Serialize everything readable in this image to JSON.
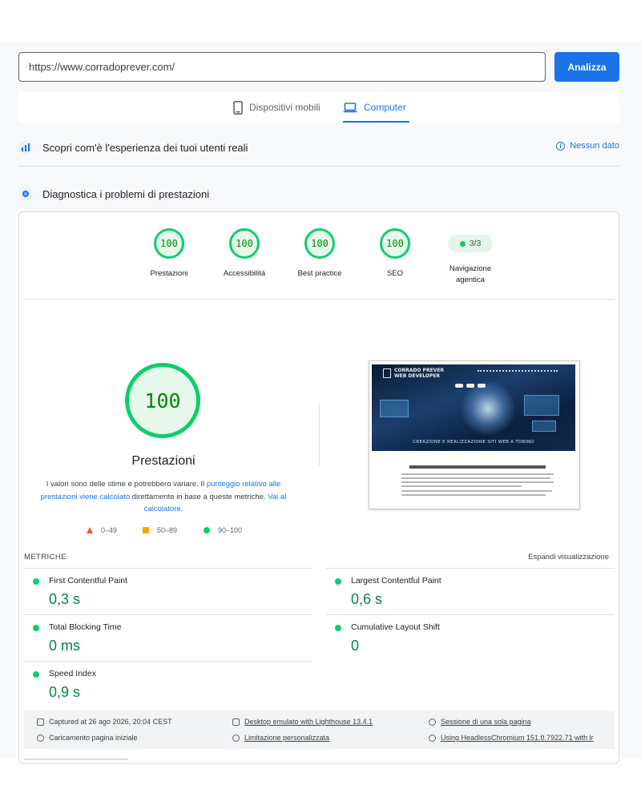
{
  "url_bar": {
    "value": "https://www.corradoprever.com/",
    "analyze_label": "Analizza"
  },
  "device_tabs": {
    "mobile": "Dispositivi mobili",
    "desktop": "Computer",
    "active": "desktop"
  },
  "field_data": {
    "title": "Scopri com'è l'esperienza dei tuoi utenti reali",
    "status": "Nessun dato"
  },
  "lab_data": {
    "title": "Diagnostica i problemi di prestazioni"
  },
  "scores": [
    {
      "value": "100",
      "label": "Prestazioni"
    },
    {
      "value": "100",
      "label": "Accessibilità"
    },
    {
      "value": "100",
      "label": "Best practice"
    },
    {
      "value": "100",
      "label": "SEO"
    }
  ],
  "agentic": {
    "value": "3/3",
    "label": "Navigazione agentica"
  },
  "performance": {
    "score": "100",
    "title": "Prestazioni",
    "desc_1": "I valori sono delle stime e potrebbero variare. Il ",
    "desc_link_1": "punteggio relativo alle prestazioni viene calcolato",
    "desc_2": " direttamente in base a queste metriche. ",
    "desc_link_2": "Vai al calcolatore.",
    "legend": [
      "0–49",
      "50–89",
      "90–100"
    ]
  },
  "thumbnail": {
    "logo_line_1": "CORRADO PREVER",
    "logo_line_2": "WEB DEVELOPER",
    "banner": "CREAZIONE E REALIZZAZIONE SITI WEB A TORINO"
  },
  "metrics": {
    "title": "METRICHE",
    "expand_label": "Espandi visualizzazione",
    "items": [
      {
        "name": "First Contentful Paint",
        "value": "0,3 s"
      },
      {
        "name": "Largest Contentful Paint",
        "value": "0,6 s"
      },
      {
        "name": "Total Blocking Time",
        "value": "0 ms"
      },
      {
        "name": "Cumulative Layout Shift",
        "value": "0"
      },
      {
        "name": "Speed Index",
        "value": "0,9 s"
      }
    ]
  },
  "footer": {
    "captured": "Captured at 26 ago 2026, 20:04 CEST",
    "emulated": "Desktop emulato with Lighthouse 13.4.1",
    "session": "Sessione di una sola pagina",
    "load": "Caricamento pagina iniziale",
    "throttling": "Limitazione personalizzata",
    "browser": "Using HeadlessChromium 151.0.7922.71 with lr"
  },
  "colors": {
    "accent": "#1a73e8",
    "pass": "#0cce6b",
    "average": "#ffa400",
    "fail": "#ff4e42"
  }
}
